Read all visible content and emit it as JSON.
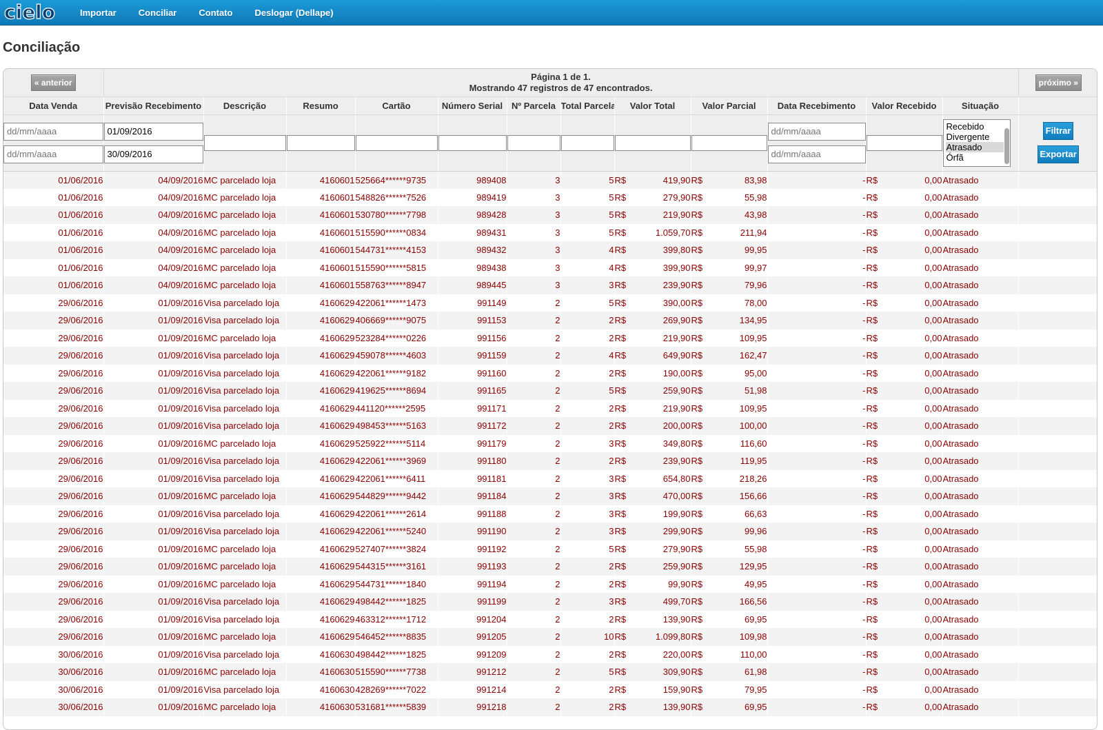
{
  "nav": {
    "logo_text": "cielo",
    "items": [
      "Importar",
      "Conciliar",
      "Contato",
      "Deslogar (Dellape)"
    ]
  },
  "page_title": "Conciliação",
  "pager": {
    "prev_label": "« anterior",
    "next_label": "próximo »",
    "page_text": "Página 1 de 1.",
    "records_text": "Mostrando 47 registros de 47 encontrados."
  },
  "columns": [
    "Data Venda",
    "Previsão Recebimento",
    "Descrição",
    "Resumo",
    "Cartão",
    "Número Serial",
    "Nº Parcela",
    "Total Parcela",
    "Valor Total",
    "Valor Parcial",
    "Data Recebimento",
    "Valor Recebido",
    "Situação"
  ],
  "filters": {
    "date_placeholder": "dd/mm/aaaa",
    "previsao_from": "01/09/2016",
    "previsao_to": "30/09/2016",
    "status_options": [
      "Recebido",
      "Divergente",
      "Atrasado",
      "Órfã"
    ],
    "status_selected": "Atrasado",
    "filter_button": "Filtrar",
    "export_button": "Exportar"
  },
  "currency": "R$",
  "colors": {
    "nav_blue": "#1485c6",
    "row_text": "#8b0000",
    "button_blue": "#1a8fd0"
  },
  "rows": [
    [
      "01/06/2016",
      "04/09/2016",
      "MC parcelado loja",
      "4160601",
      "525664******9735",
      "989408",
      "3",
      "5",
      "419,90",
      "83,98",
      "-",
      "0,00",
      "Atrasado"
    ],
    [
      "01/06/2016",
      "04/09/2016",
      "MC parcelado loja",
      "4160601",
      "548826******7526",
      "989419",
      "3",
      "5",
      "279,90",
      "55,98",
      "-",
      "0,00",
      "Atrasado"
    ],
    [
      "01/06/2016",
      "04/09/2016",
      "MC parcelado loja",
      "4160601",
      "530780******7798",
      "989428",
      "3",
      "5",
      "219,90",
      "43,98",
      "-",
      "0,00",
      "Atrasado"
    ],
    [
      "01/06/2016",
      "04/09/2016",
      "MC parcelado loja",
      "4160601",
      "515590******0834",
      "989431",
      "3",
      "5",
      "1.059,70",
      "211,94",
      "-",
      "0,00",
      "Atrasado"
    ],
    [
      "01/06/2016",
      "04/09/2016",
      "MC parcelado loja",
      "4160601",
      "544731******4153",
      "989432",
      "3",
      "4",
      "399,80",
      "99,95",
      "-",
      "0,00",
      "Atrasado"
    ],
    [
      "01/06/2016",
      "04/09/2016",
      "MC parcelado loja",
      "4160601",
      "515590******5815",
      "989438",
      "3",
      "4",
      "399,90",
      "99,97",
      "-",
      "0,00",
      "Atrasado"
    ],
    [
      "01/06/2016",
      "04/09/2016",
      "MC parcelado loja",
      "4160601",
      "558763******8947",
      "989445",
      "3",
      "3",
      "239,90",
      "79,96",
      "-",
      "0,00",
      "Atrasado"
    ],
    [
      "29/06/2016",
      "01/09/2016",
      "Visa parcelado loja",
      "4160629",
      "422061******1473",
      "991149",
      "2",
      "5",
      "390,00",
      "78,00",
      "-",
      "0,00",
      "Atrasado"
    ],
    [
      "29/06/2016",
      "01/09/2016",
      "Visa parcelado loja",
      "4160629",
      "406669******9075",
      "991153",
      "2",
      "2",
      "269,90",
      "134,95",
      "-",
      "0,00",
      "Atrasado"
    ],
    [
      "29/06/2016",
      "01/09/2016",
      "MC parcelado loja",
      "4160629",
      "523284******0226",
      "991156",
      "2",
      "2",
      "219,90",
      "109,95",
      "-",
      "0,00",
      "Atrasado"
    ],
    [
      "29/06/2016",
      "01/09/2016",
      "Visa parcelado loja",
      "4160629",
      "459078******4603",
      "991159",
      "2",
      "4",
      "649,90",
      "162,47",
      "-",
      "0,00",
      "Atrasado"
    ],
    [
      "29/06/2016",
      "01/09/2016",
      "Visa parcelado loja",
      "4160629",
      "422061******9182",
      "991160",
      "2",
      "2",
      "190,00",
      "95,00",
      "-",
      "0,00",
      "Atrasado"
    ],
    [
      "29/06/2016",
      "01/09/2016",
      "Visa parcelado loja",
      "4160629",
      "419625******8694",
      "991165",
      "2",
      "5",
      "259,90",
      "51,98",
      "-",
      "0,00",
      "Atrasado"
    ],
    [
      "29/06/2016",
      "01/09/2016",
      "Visa parcelado loja",
      "4160629",
      "441120******2595",
      "991171",
      "2",
      "2",
      "219,90",
      "109,95",
      "-",
      "0,00",
      "Atrasado"
    ],
    [
      "29/06/2016",
      "01/09/2016",
      "Visa parcelado loja",
      "4160629",
      "498453******5163",
      "991172",
      "2",
      "2",
      "200,00",
      "100,00",
      "-",
      "0,00",
      "Atrasado"
    ],
    [
      "29/06/2016",
      "01/09/2016",
      "MC parcelado loja",
      "4160629",
      "525922******5114",
      "991179",
      "2",
      "3",
      "349,80",
      "116,60",
      "-",
      "0,00",
      "Atrasado"
    ],
    [
      "29/06/2016",
      "01/09/2016",
      "Visa parcelado loja",
      "4160629",
      "422061******3969",
      "991180",
      "2",
      "2",
      "239,90",
      "119,95",
      "-",
      "0,00",
      "Atrasado"
    ],
    [
      "29/06/2016",
      "01/09/2016",
      "Visa parcelado loja",
      "4160629",
      "422061******6411",
      "991181",
      "2",
      "3",
      "654,80",
      "218,26",
      "-",
      "0,00",
      "Atrasado"
    ],
    [
      "29/06/2016",
      "01/09/2016",
      "MC parcelado loja",
      "4160629",
      "544829******9442",
      "991184",
      "2",
      "3",
      "470,00",
      "156,66",
      "-",
      "0,00",
      "Atrasado"
    ],
    [
      "29/06/2016",
      "01/09/2016",
      "Visa parcelado loja",
      "4160629",
      "422061******2614",
      "991188",
      "2",
      "3",
      "199,90",
      "66,63",
      "-",
      "0,00",
      "Atrasado"
    ],
    [
      "29/06/2016",
      "01/09/2016",
      "Visa parcelado loja",
      "4160629",
      "422061******5240",
      "991190",
      "2",
      "3",
      "299,90",
      "99,96",
      "-",
      "0,00",
      "Atrasado"
    ],
    [
      "29/06/2016",
      "01/09/2016",
      "MC parcelado loja",
      "4160629",
      "527407******3824",
      "991192",
      "2",
      "5",
      "279,90",
      "55,98",
      "-",
      "0,00",
      "Atrasado"
    ],
    [
      "29/06/2016",
      "01/09/2016",
      "MC parcelado loja",
      "4160629",
      "544315******3161",
      "991193",
      "2",
      "2",
      "259,90",
      "129,95",
      "-",
      "0,00",
      "Atrasado"
    ],
    [
      "29/06/2016",
      "01/09/2016",
      "MC parcelado loja",
      "4160629",
      "544731******1840",
      "991194",
      "2",
      "2",
      "99,90",
      "49,95",
      "-",
      "0,00",
      "Atrasado"
    ],
    [
      "29/06/2016",
      "01/09/2016",
      "Visa parcelado loja",
      "4160629",
      "498442******1825",
      "991199",
      "2",
      "3",
      "499,70",
      "166,56",
      "-",
      "0,00",
      "Atrasado"
    ],
    [
      "29/06/2016",
      "01/09/2016",
      "Visa parcelado loja",
      "4160629",
      "463312******1712",
      "991204",
      "2",
      "2",
      "139,90",
      "69,95",
      "-",
      "0,00",
      "Atrasado"
    ],
    [
      "29/06/2016",
      "01/09/2016",
      "MC parcelado loja",
      "4160629",
      "546452******8835",
      "991205",
      "2",
      "10",
      "1.099,80",
      "109,98",
      "-",
      "0,00",
      "Atrasado"
    ],
    [
      "30/06/2016",
      "01/09/2016",
      "Visa parcelado loja",
      "4160630",
      "498442******1825",
      "991209",
      "2",
      "2",
      "220,00",
      "110,00",
      "-",
      "0,00",
      "Atrasado"
    ],
    [
      "30/06/2016",
      "01/09/2016",
      "MC parcelado loja",
      "4160630",
      "515590******7738",
      "991212",
      "2",
      "5",
      "309,90",
      "61,98",
      "-",
      "0,00",
      "Atrasado"
    ],
    [
      "30/06/2016",
      "01/09/2016",
      "Visa parcelado loja",
      "4160630",
      "428269******7022",
      "991214",
      "2",
      "2",
      "159,90",
      "79,95",
      "-",
      "0,00",
      "Atrasado"
    ],
    [
      "30/06/2016",
      "01/09/2016",
      "MC parcelado loja",
      "4160630",
      "531681******5839",
      "991218",
      "2",
      "2",
      "139,90",
      "69,95",
      "-",
      "0,00",
      "Atrasado"
    ]
  ]
}
